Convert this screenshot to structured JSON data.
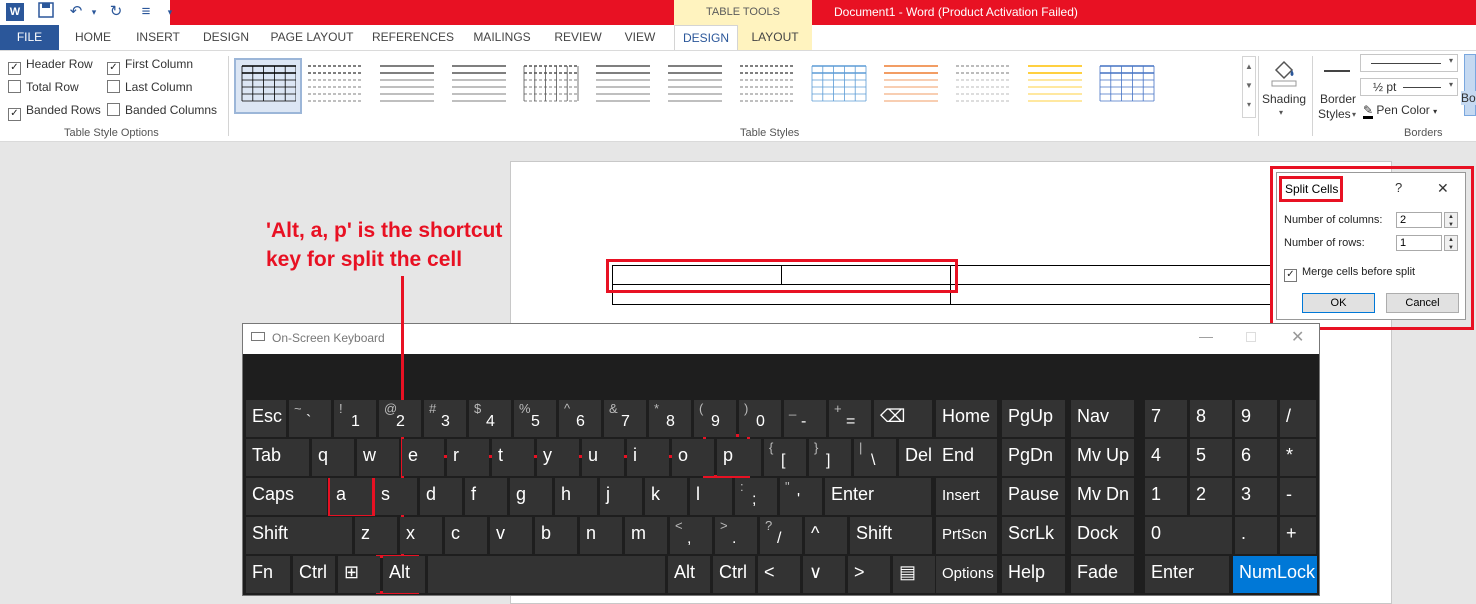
{
  "title_bar": {
    "table_tools": "TABLE TOOLS",
    "document_title": "Document1 -  Word (Product Activation Failed)",
    "quick_access": [
      "word-logo-icon",
      "save-icon",
      "undo-icon",
      "redo-icon",
      "touch-mode-icon",
      "customize-icon"
    ]
  },
  "tabs": [
    "FILE",
    "HOME",
    "INSERT",
    "DESIGN",
    "PAGE LAYOUT",
    "REFERENCES",
    "MAILINGS",
    "REVIEW",
    "VIEW",
    "DESIGN",
    "LAYOUT"
  ],
  "table_style_options": {
    "items": [
      {
        "label": "Header Row",
        "checked": true
      },
      {
        "label": "First Column",
        "checked": true
      },
      {
        "label": "Total Row",
        "checked": false
      },
      {
        "label": "Last Column",
        "checked": false
      },
      {
        "label": "Banded Rows",
        "checked": true
      },
      {
        "label": "Banded Columns",
        "checked": false
      }
    ],
    "group_label": "Table Style Options"
  },
  "table_styles": {
    "group_label": "Table Styles",
    "count": 13,
    "accent_colors": [
      "#000000",
      "#555555",
      "#555555",
      "#555555",
      "#555555",
      "#555555",
      "#555555",
      "#555555",
      "#5b9bd5",
      "#ed7d31",
      "#a5a5a5",
      "#ffc000",
      "#4472c4",
      "#70ad47"
    ]
  },
  "shading": {
    "label": "Shading"
  },
  "borders": {
    "border_styles_line1": "Border",
    "border_styles_line2": "Styles",
    "pen_weight": "½ pt",
    "pen_color": "Pen Color",
    "group_label": "Borders",
    "cut_label": "Bo"
  },
  "annotation": {
    "line1": "'Alt, a, p' is the shortcut",
    "line2": "key for split the cell"
  },
  "dialog": {
    "title": "Split Cells",
    "help": "?",
    "close": "✕",
    "columns_label": "Number of columns:",
    "columns_value": "2",
    "rows_label": "Number of rows:",
    "rows_value": "1",
    "merge_label": "Merge cells before split",
    "merge_checked": true,
    "ok": "OK",
    "cancel": "Cancel"
  },
  "osk": {
    "title": "On-Screen Keyboard",
    "rows": [
      [
        [
          "Esc",
          ""
        ],
        [
          "~",
          "`"
        ],
        [
          "!",
          "1"
        ],
        [
          "@",
          "2"
        ],
        [
          "#",
          "3"
        ],
        [
          "$",
          "4"
        ],
        [
          "%",
          "5"
        ],
        [
          "^",
          "6"
        ],
        [
          "&",
          "7"
        ],
        [
          "*",
          "8"
        ],
        [
          "(",
          "9"
        ],
        [
          ")",
          "0"
        ],
        [
          "_",
          "-"
        ],
        [
          "+",
          "="
        ],
        [
          "⌫",
          ""
        ]
      ],
      [
        [
          "Tab",
          ""
        ],
        [
          "q",
          ""
        ],
        [
          "w",
          ""
        ],
        [
          "e",
          ""
        ],
        [
          "r",
          ""
        ],
        [
          "t",
          ""
        ],
        [
          "y",
          ""
        ],
        [
          "u",
          ""
        ],
        [
          "i",
          ""
        ],
        [
          "o",
          ""
        ],
        [
          "p",
          ""
        ],
        [
          "{",
          "["
        ],
        [
          "}",
          "]"
        ],
        [
          "|",
          "\\"
        ],
        [
          "Del",
          ""
        ]
      ],
      [
        [
          "Caps",
          ""
        ],
        [
          "a",
          ""
        ],
        [
          "s",
          ""
        ],
        [
          "d",
          ""
        ],
        [
          "f",
          ""
        ],
        [
          "g",
          ""
        ],
        [
          "h",
          ""
        ],
        [
          "j",
          ""
        ],
        [
          "k",
          ""
        ],
        [
          "l",
          ""
        ],
        [
          ":",
          ";"
        ],
        [
          "\"",
          "'"
        ],
        [
          "Enter",
          ""
        ]
      ],
      [
        [
          "Shift",
          ""
        ],
        [
          "z",
          ""
        ],
        [
          "x",
          ""
        ],
        [
          "c",
          ""
        ],
        [
          "v",
          ""
        ],
        [
          "b",
          ""
        ],
        [
          "n",
          ""
        ],
        [
          "m",
          ""
        ],
        [
          "<",
          ","
        ],
        [
          ">",
          "."
        ],
        [
          "?",
          "/"
        ],
        [
          "^",
          ""
        ],
        [
          "Shift",
          ""
        ]
      ],
      [
        [
          "Fn",
          ""
        ],
        [
          "Ctrl",
          ""
        ],
        [
          "⊞",
          ""
        ],
        [
          "Alt",
          ""
        ],
        [
          "",
          ""
        ],
        [
          "Alt",
          ""
        ],
        [
          "Ctrl",
          ""
        ],
        [
          "<",
          ""
        ],
        [
          "∨",
          ""
        ],
        [
          ">",
          ""
        ],
        [
          "▤",
          ""
        ]
      ]
    ],
    "nav": [
      [
        "Home",
        "PgUp",
        "Nav"
      ],
      [
        "End",
        "PgDn",
        "Mv Up"
      ],
      [
        "Insert",
        "Pause",
        "Mv Dn"
      ],
      [
        "PrtScn",
        "ScrLk",
        "Dock"
      ],
      [
        "Options",
        "Help",
        "Fade"
      ]
    ],
    "numpad": [
      [
        "7",
        "8",
        "9",
        "/"
      ],
      [
        "4",
        "5",
        "6",
        "*"
      ],
      [
        "1",
        "2",
        "3",
        "-"
      ],
      [
        "0",
        "",
        ".",
        "+"
      ],
      [
        "Enter",
        "",
        "NumLock",
        ""
      ]
    ]
  }
}
